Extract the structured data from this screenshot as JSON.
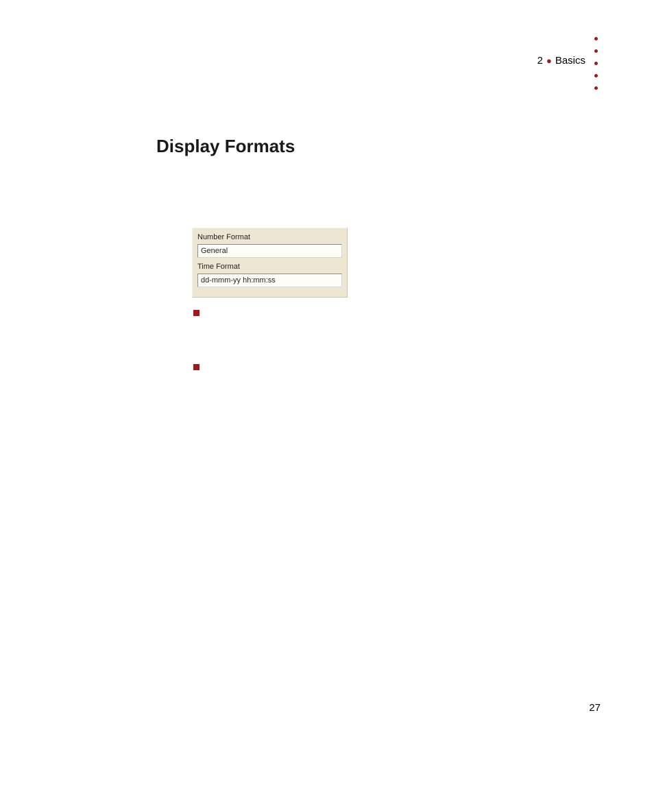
{
  "header": {
    "chapter_number": "2",
    "chapter_title": "Basics"
  },
  "title": "Display Formats",
  "panel": {
    "label_number": "Number Format",
    "value_number": "General",
    "label_time": "Time Format",
    "value_time": "dd-mmm-yy hh:mm:ss"
  },
  "page_number": "27"
}
